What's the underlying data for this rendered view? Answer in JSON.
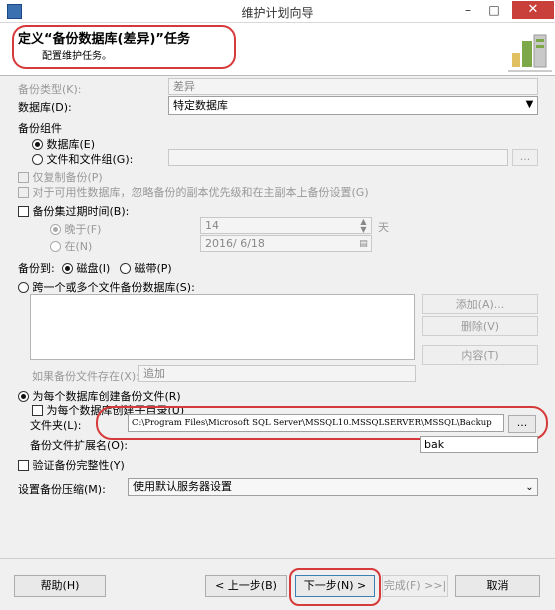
{
  "window": {
    "title": "维护计划向导",
    "minimize": "–",
    "maximize": "□",
    "close": "✕"
  },
  "header": {
    "title": "定义“备份数据库(差异)”任务",
    "subtitle": "配置维护任务。"
  },
  "backup_type": {
    "label": "备份类型(K):",
    "value": "差异"
  },
  "database": {
    "label": "数据库(D):",
    "value": "特定数据库"
  },
  "backup_component": {
    "label": "备份组件",
    "db_label": "数据库(E)",
    "files_label": "文件和文件组(G):",
    "browse": "..."
  },
  "copy_only": {
    "label": "仅复制备份(P)"
  },
  "ag_pref": {
    "label": "对于可用性数据库，忽略备份的副本优先级和在主副本上备份设置(G)"
  },
  "expire": {
    "label": "备份集过期时间(B):",
    "after_label": "晚于(F)",
    "after_value": "14",
    "unit": "天",
    "on_label": "在(N)",
    "on_value": "2016/ 6/18"
  },
  "backup_to": {
    "label": "备份到:",
    "disk": "磁盘(I)",
    "tape": "磁带(P)"
  },
  "span": {
    "label": "跨一个或多个文件备份数据库(S):",
    "add": "添加(A)...",
    "delete": "删除(V)",
    "content": "内容(T)"
  },
  "if_exists": {
    "label": "如果备份文件存在(X):",
    "value": "追加"
  },
  "per_db": {
    "label": "为每个数据库创建备份文件(R)",
    "subdir": "为每个数据库创建子目录(U)",
    "folder_label": "文件夹(L):",
    "folder_value": "C:\\Program Files\\Microsoft SQL Server\\MSSQL10.MSSQLSERVER\\MSSQL\\Backup",
    "folder_btn": "...",
    "ext_label": "备份文件扩展名(O):",
    "ext_value": "bak"
  },
  "verify": {
    "label": "验证备份完整性(Y)"
  },
  "compress": {
    "label": "设置备份压缩(M):",
    "value": "使用默认服务器设置"
  },
  "footer": {
    "help": "帮助(H)",
    "back": "< 上一步(B)",
    "next": "下一步(N) >",
    "finish": "完成(F) >>|",
    "cancel": "取消"
  },
  "colors": {
    "accent_red": "#d63a3a",
    "close_red": "#c9403a"
  }
}
